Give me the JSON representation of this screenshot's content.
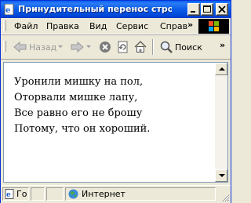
{
  "window": {
    "title": "Принудительный перенос строки - Mi"
  },
  "menu": {
    "items": [
      "Файл",
      "Правка",
      "Вид",
      "Сервис",
      "Справ"
    ],
    "more": "»"
  },
  "toolbar": {
    "back_label": "Назад",
    "search_label": "Поиск",
    "more": "»"
  },
  "content": {
    "lines": [
      "Уронили мишку на пол,",
      "Оторвали мишке лапу,",
      "Все равно его не брошу",
      "Потому, что он хороший."
    ]
  },
  "statusbar": {
    "left_text": "Го",
    "zone_text": "Интернет"
  }
}
